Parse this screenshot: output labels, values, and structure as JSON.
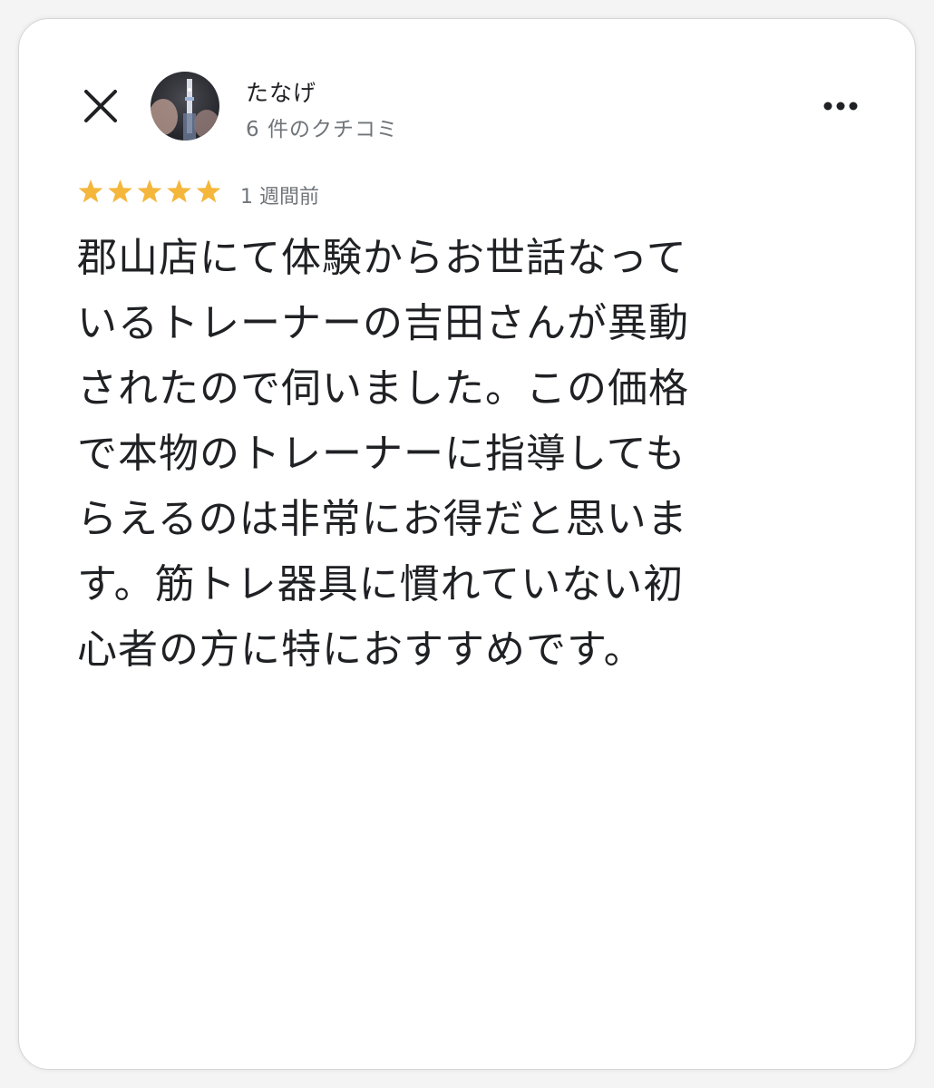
{
  "header": {
    "close_icon": "close-icon",
    "avatar_icon": "avatar-photo",
    "reviewer_name": "たなげ",
    "review_count": "6 件のクチコミ",
    "more_icon": "more-horizontal-icon"
  },
  "review": {
    "rating": 5,
    "rating_max": 5,
    "star_color": "#F4B73C",
    "time": "1 週間前",
    "lines": [
      "郡山店にて体験からお世話なって",
      "いるトレーナーの吉田さんが異動",
      "されたので伺いました。この価格",
      "で本物のトレーナーに指導しても",
      "らえるのは非常にお得だと思いま",
      "す。筋トレ器具に慣れていない初",
      "心者の方に特におすすめです。"
    ]
  }
}
